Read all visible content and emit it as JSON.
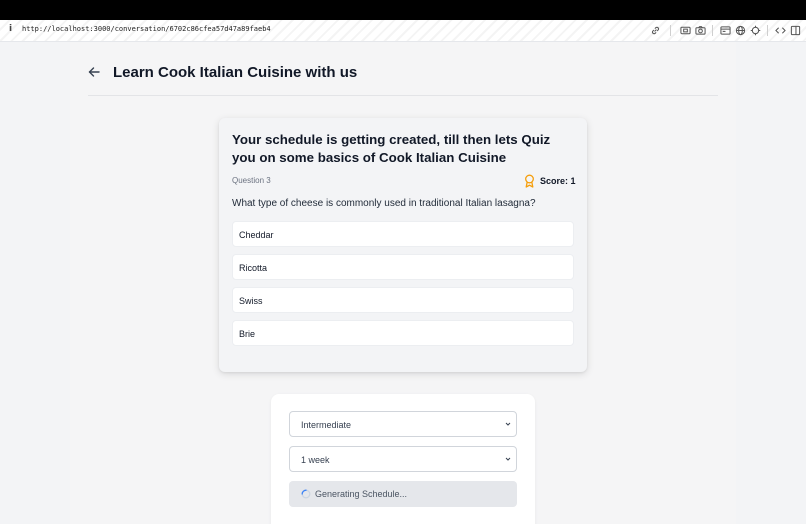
{
  "browser": {
    "url": "http://localhost:3000/conversation/6702c86cfea57d47a89faeb4",
    "toolbar_icons": [
      "link-icon",
      "screenshot-icon",
      "camera-icon",
      "window-icon",
      "globe-icon",
      "crosshair-icon",
      "code-icon",
      "split-view-icon"
    ]
  },
  "header": {
    "title": "Learn Cook Italian Cuisine with us"
  },
  "quiz": {
    "heading": "Your schedule is getting created, till then lets Quiz you on some basics of Cook Italian Cuisine",
    "question_number": "Question 3",
    "score": "Score: 1",
    "question": "What type of cheese is commonly used in traditional Italian lasagna?",
    "options": [
      "Cheddar",
      "Ricotta",
      "Swiss",
      "Brie"
    ]
  },
  "schedule": {
    "level_selected": "Intermediate",
    "duration_selected": "1 week",
    "button_label": "Generating Schedule..."
  },
  "colors": {
    "accent_gold": "#f59e0b",
    "spinner_blue": "#3b82f6"
  }
}
